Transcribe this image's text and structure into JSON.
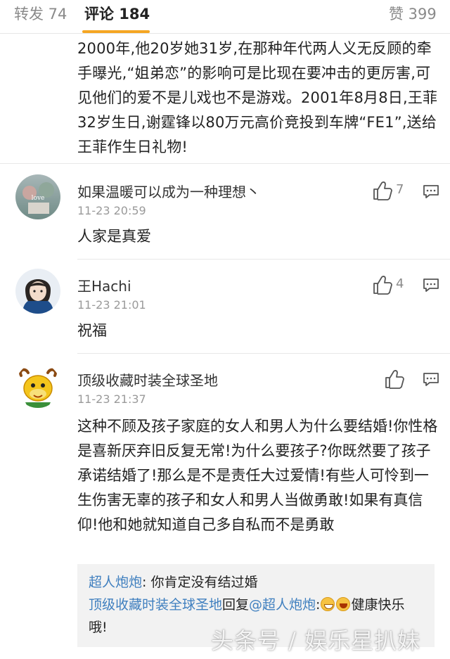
{
  "tabs": [
    {
      "label": "转发 74"
    },
    {
      "label": "评论 184"
    },
    {
      "label": "赞 399"
    }
  ],
  "post_text": "2000年,他20岁她31岁,在那种年代两人义无反顾的牵手曝光,“姐弟恋”的影响可是比现在要冲击的更厉害,可见他们的爱不是儿戏也不是游戏。2001年8月8日,王菲32岁生日,谢霆锋以80万元高价竞投到车牌“FE1”,送给王菲作生日礼物!",
  "comments": [
    {
      "user": "如果温暖可以成为一种理想丶",
      "time": "11-23 20:59",
      "likes": "7",
      "text": "人家是真爱"
    },
    {
      "user": "王Hachi",
      "time": "11-23 21:01",
      "likes": "4",
      "text": "祝福"
    },
    {
      "user": "顶级收藏时装全球圣地",
      "time": "11-23 21:37",
      "likes": "",
      "text": "这种不顾及孩子家庭的女人和男人为什么要结婚!你性格是喜新厌弃旧反复无常!为什么要孩子?你既然要了孩子承诺结婚了!那么是不是责任大过爱情!有些人可怜到一生伤害无辜的孩子和女人和男人当做勇敢!如果有真信仰!他和她就知道自己多自私而不是勇敢"
    }
  ],
  "replies": {
    "r1_user": "超人炮炮",
    "r1_text": ": 你肯定没有结过婚",
    "r2_user": "顶级收藏时装全球圣地",
    "r2_mid": "回复",
    "r2_target": "@超人炮炮",
    "r2_colon": ":",
    "r2_text": "健康快乐哦!"
  },
  "watermark": "头条号 / 娱乐星扒妹",
  "colors": {
    "accent": "#f5a623",
    "link": "#3f7fbf",
    "reply_bg": "#f2f2f2"
  }
}
